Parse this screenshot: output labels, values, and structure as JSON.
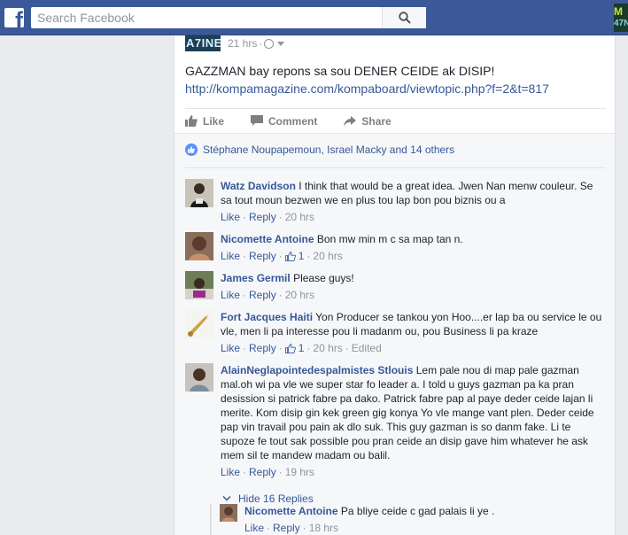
{
  "topbar": {
    "logo_letter": "f",
    "search_placeholder": "Search Facebook",
    "corner_text_1": "M",
    "corner_text_2": "47N"
  },
  "post": {
    "page_thumb_text": "A7INE",
    "time": "21 hrs",
    "text": "GAZZMAN bay repons sa sou DENER CEIDE ak DISIP!",
    "link": "http://kompamagazine.com/kompaboard/viewtopic.php?f=2&t=817",
    "actions": {
      "like": "Like",
      "comment": "Comment",
      "share": "Share"
    },
    "likes_summary": "Stéphane Noupapemoun, Israel Macky and 14 others"
  },
  "comments": [
    {
      "name": "Watz Davidson",
      "text": "I think that would be a great idea. Jwen Nan menw couleur. Se sa tout moun bezwen we en plus tou lap bon pou biznis ou a",
      "like": "Like",
      "reply": "Reply",
      "time": "20 hrs"
    },
    {
      "name": "Nicomette Antoine",
      "text": "Bon mw min m c sa map tan n.",
      "like": "Like",
      "reply": "Reply",
      "likes": "1",
      "time": "20 hrs"
    },
    {
      "name": "James Germil",
      "text": "Please guys!",
      "like": "Like",
      "reply": "Reply",
      "time": "20 hrs"
    },
    {
      "name": "Fort Jacques Haiti",
      "text": "Yon Producer se tankou yon Hoo....er lap ba ou service le ou vle, men li pa interesse pou li madanm ou, pou Business li pa kraze",
      "like": "Like",
      "reply": "Reply",
      "likes": "1",
      "time": "20 hrs",
      "edited": "Edited"
    },
    {
      "name": "AlainNeglapointedespalmistes Stlouis",
      "text": "Lem pale nou di map pale gazman mal.oh wi pa vle we super star fo leader a. I told u guys gazman pa ka pran desission si patrick fabre pa dako. Patrick fabre pap al paye deder ceide lajan li merite. Kom disip gin kek green gig konya Yo vle mange vant plen. Deder ceide pap vin travail pou pain ak dlo suk. This guy gazman is so danm fake. Li te supoze fe tout sak possible pou pran ceide an disip gave him whatever he ask mem sil te mandew madam ou balil.",
      "like": "Like",
      "reply": "Reply",
      "time": "19 hrs"
    }
  ],
  "replies_toggle": "Hide 16 Replies",
  "reply": {
    "name": "Nicomette Antoine",
    "text": "Pa bliye ceide c gad palais li ye .",
    "like": "Like",
    "reply": "Reply",
    "time": "18 hrs"
  },
  "colors": {
    "brand": "#3b5998",
    "link": "#365899",
    "meta": "#90949c"
  }
}
